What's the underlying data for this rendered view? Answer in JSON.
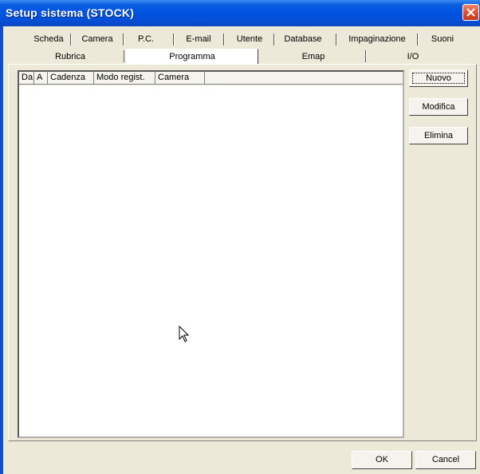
{
  "window": {
    "title": "Setup sistema (STOCK)"
  },
  "tabs": {
    "row1": [
      "Scheda",
      "Camera",
      "P.C.",
      "E-mail",
      "Utente",
      "Database",
      "Impaginazione",
      "Suoni"
    ],
    "row2": [
      "Rubrica",
      "Programma",
      "Emap",
      "I/O"
    ],
    "selected": "Programma"
  },
  "list": {
    "columns": [
      "Da",
      "A",
      "Cadenza",
      "Modo regist.",
      "Camera"
    ],
    "rows": []
  },
  "actions": {
    "new": "Nuovo",
    "edit": "Modifica",
    "delete": "Elimina"
  },
  "footer": {
    "ok": "OK",
    "cancel": "Cancel"
  },
  "colors": {
    "titlebar": "#0054e3",
    "dialog_bg": "#ece9d8",
    "close_button": "#e0502e"
  }
}
